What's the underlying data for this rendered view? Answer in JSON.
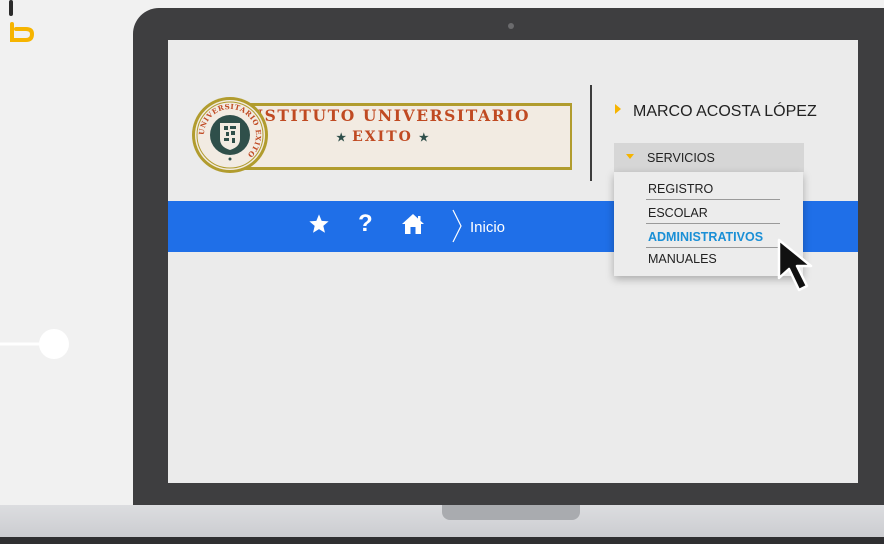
{
  "colors": {
    "nav_blue": "#1f6fe8",
    "accent_yellow": "#f6b400",
    "active_blue": "#1a8fd6",
    "logo_red": "#c04a22",
    "logo_green": "#2f4f4a",
    "laptop_frame": "#3e3e40"
  },
  "brand": {
    "title": "INSTITUTO UNIVERSITARIO",
    "subtitle": "EXITO",
    "seal_text": "UNIVERSITARIO EXITO"
  },
  "header": {
    "user_name": "MARCO ACOSTA LÓPEZ",
    "services_label": "SERVICIOS"
  },
  "menu": {
    "items": [
      {
        "label": "REGISTRO",
        "active": false
      },
      {
        "label": "ESCOLAR",
        "active": false
      },
      {
        "label": "ADMINISTRATIVOS",
        "active": true
      },
      {
        "label": "MANUALES",
        "active": false
      }
    ]
  },
  "nav": {
    "favorites_icon": "star-icon",
    "help_icon": "help-icon",
    "help_glyph": "?",
    "home_icon": "home-icon",
    "breadcrumb": "Inicio"
  }
}
